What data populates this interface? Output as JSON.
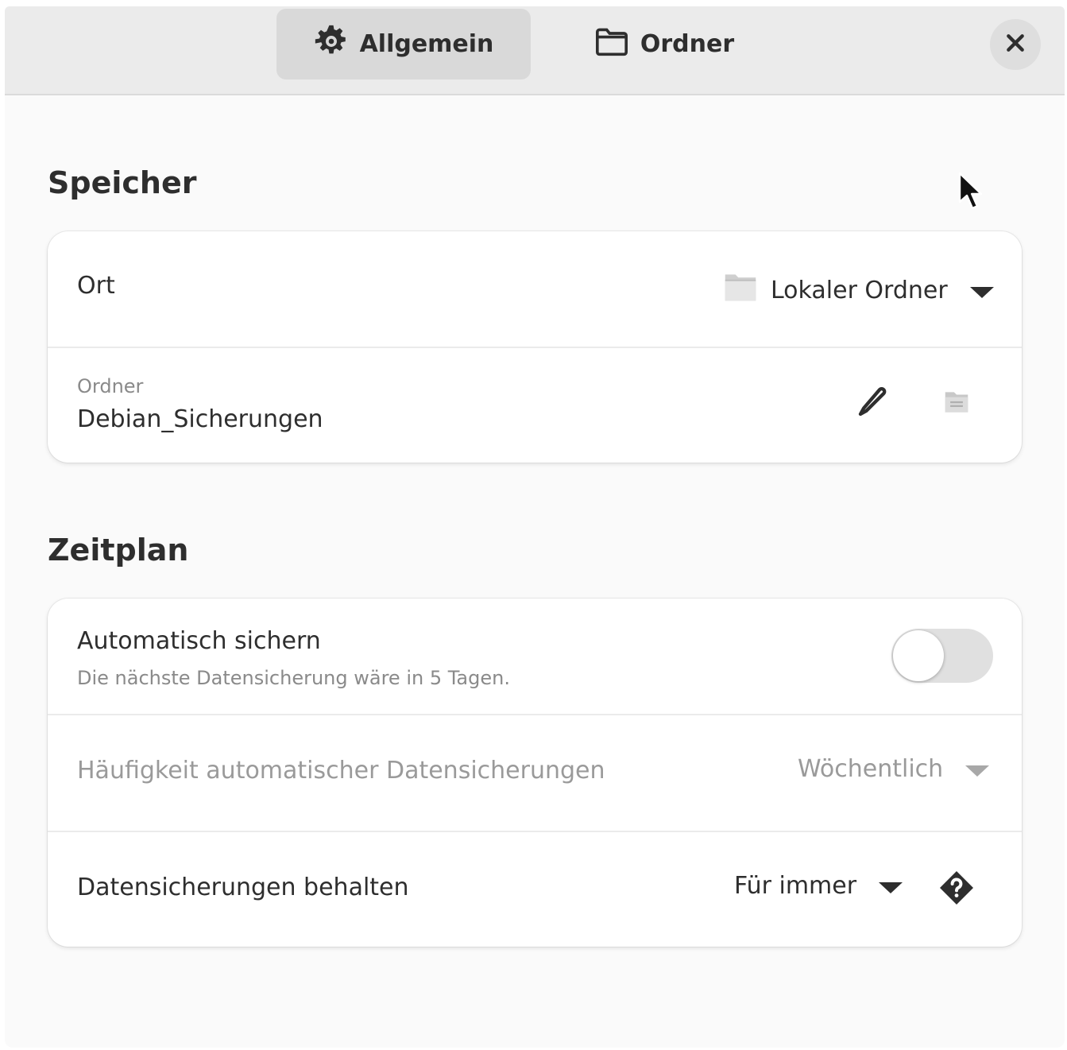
{
  "tabs": [
    {
      "label": "Allgemein",
      "icon": "gear-icon",
      "active": true
    },
    {
      "label": "Ordner",
      "icon": "folder-icon",
      "active": false
    }
  ],
  "close_icon": "close-icon",
  "storage": {
    "title": "Speicher",
    "location": {
      "label": "Ort",
      "value": "Lokaler Ordner",
      "icon": "folder-icon"
    },
    "folder": {
      "caption": "Ordner",
      "value": "Debian_Sicherungen",
      "edit_icon": "pencil-icon",
      "browse_icon": "folder-browse-icon"
    }
  },
  "schedule": {
    "title": "Zeitplan",
    "auto_backup": {
      "label": "Automatisch sichern",
      "subtitle": "Die nächste Datensicherung wäre in 5 Tagen.",
      "enabled": false
    },
    "frequency": {
      "label": "Häufigkeit automatischer Datensicherungen",
      "value": "Wöchentlich"
    },
    "keep": {
      "label": "Datensicherungen behalten",
      "value": "Für immer",
      "help_icon": "help-icon"
    }
  },
  "colors": {
    "accent_text": "#2e2e2e",
    "dim_text": "#9a9a9a",
    "header_bg": "#ebebeb",
    "card_bg": "#ffffff"
  }
}
